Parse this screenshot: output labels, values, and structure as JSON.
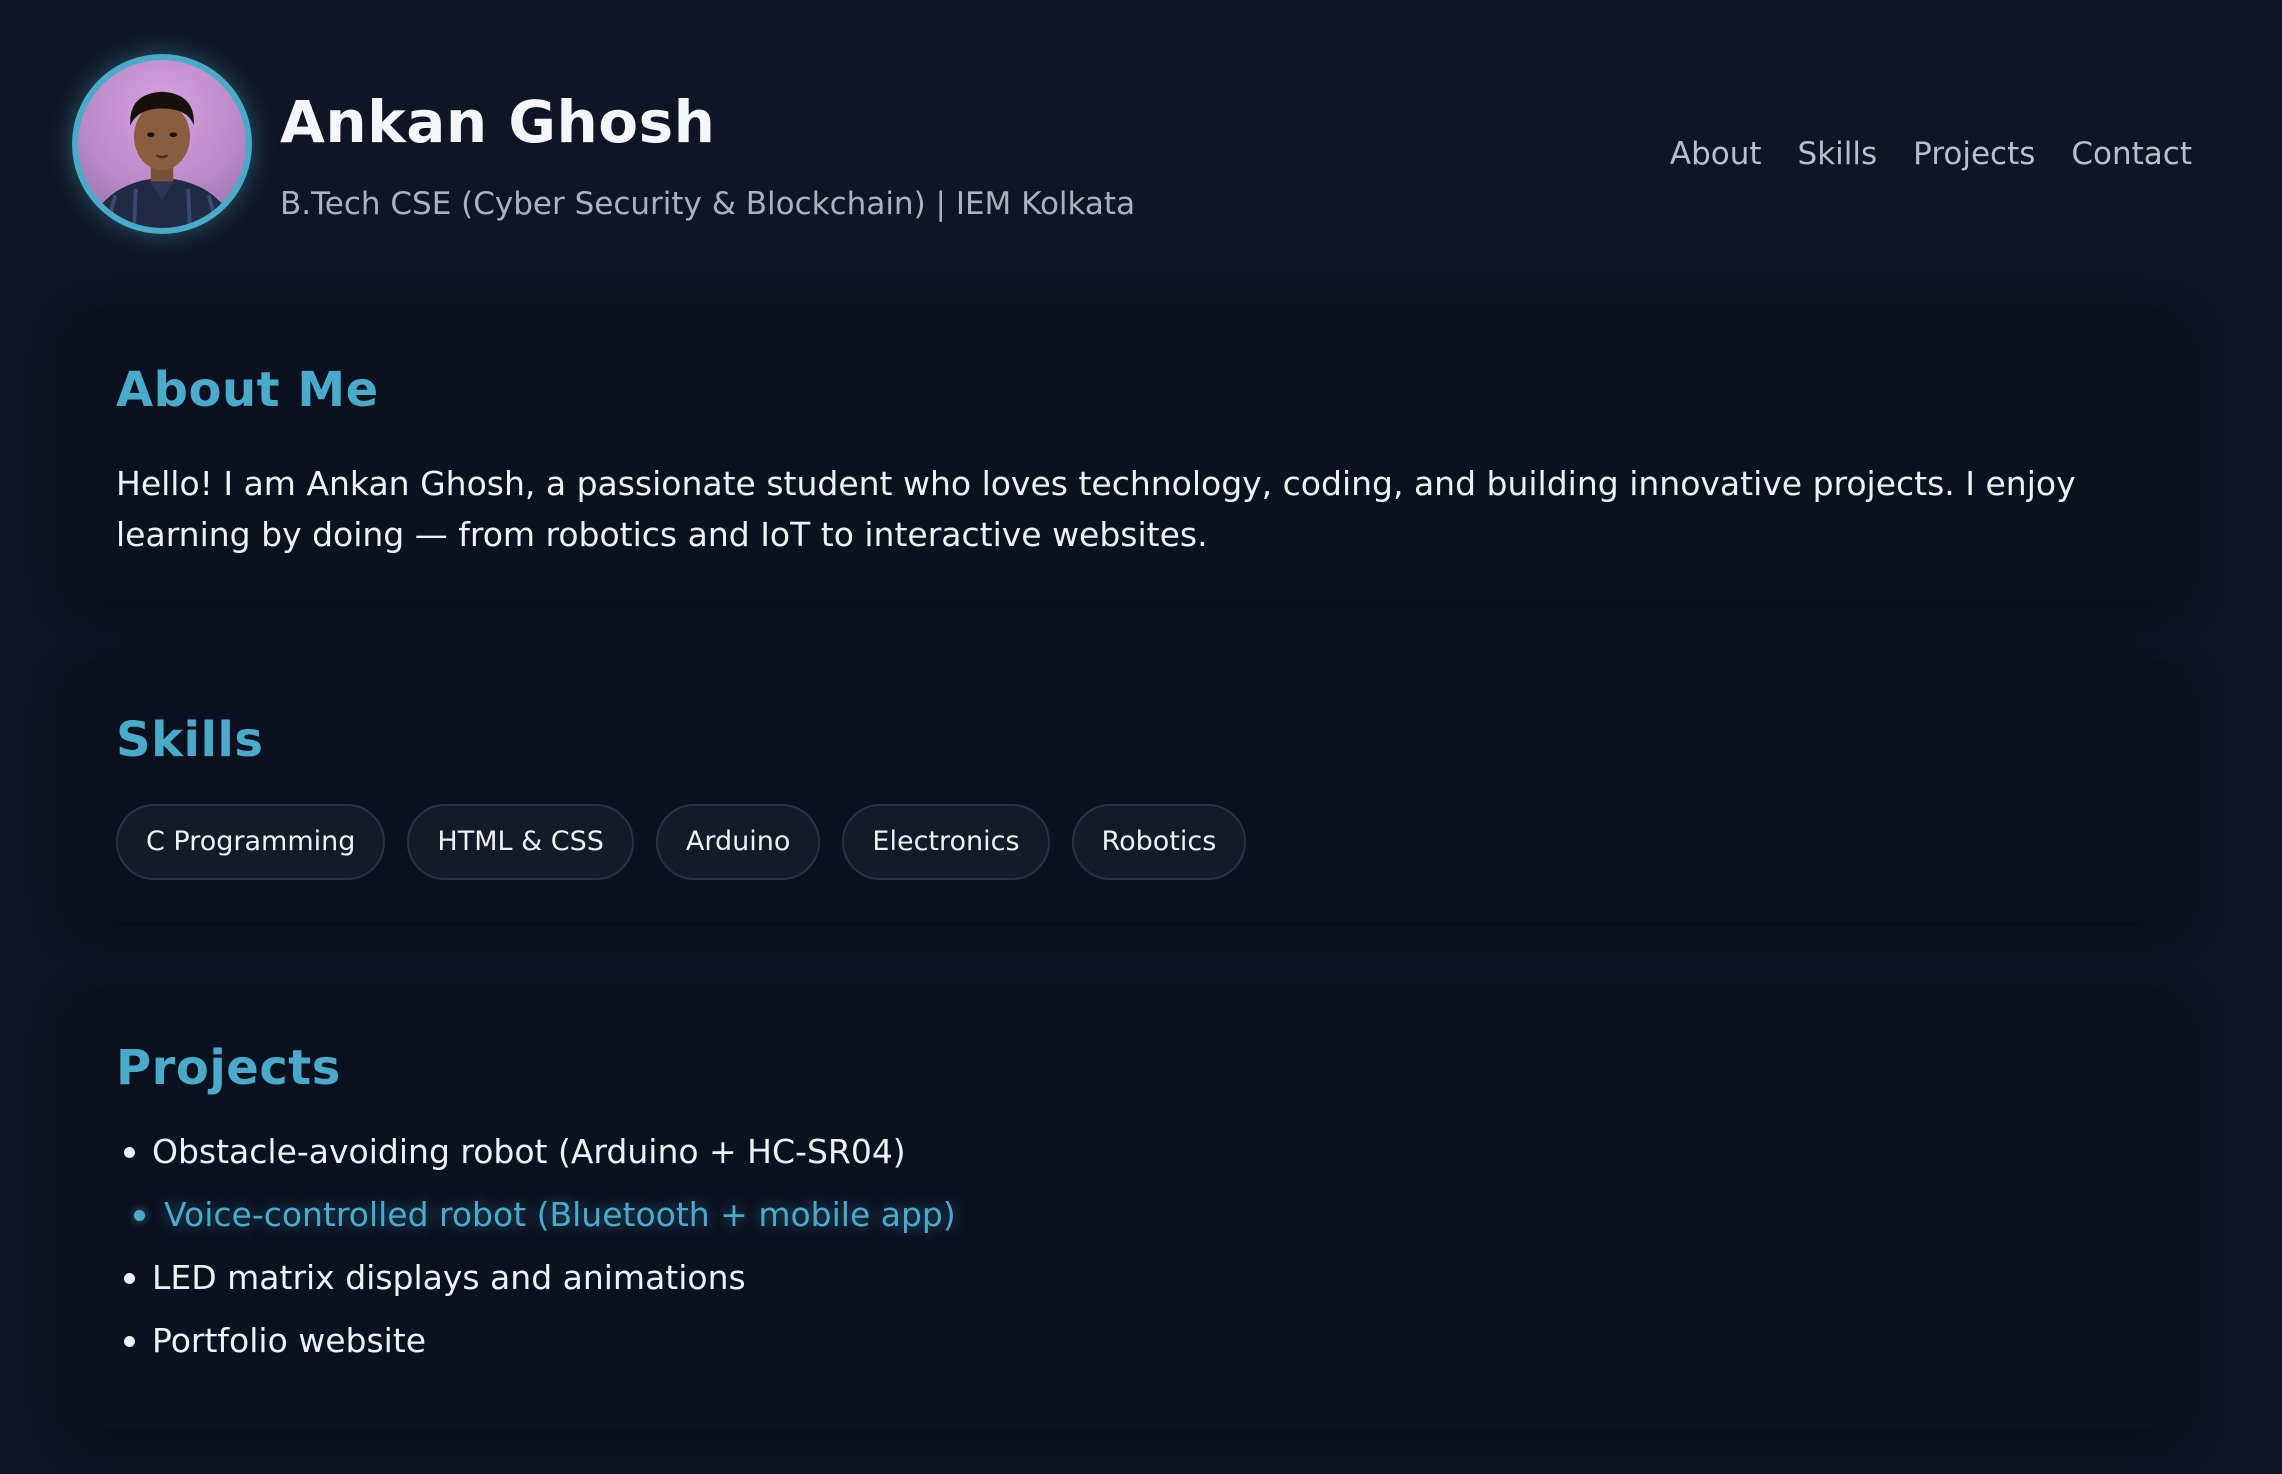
{
  "profile": {
    "name": "Ankan Ghosh",
    "tagline": "B.Tech CSE (Cyber Security & Blockchain) | IEM Kolkata"
  },
  "nav": {
    "items": [
      "About",
      "Skills",
      "Projects",
      "Contact"
    ]
  },
  "about": {
    "heading": "About Me",
    "text": "Hello! I am Ankan Ghosh, a passionate student who loves technology, coding, and building innovative projects. I enjoy learning by doing — from robotics and IoT to interactive websites."
  },
  "skills": {
    "heading": "Skills",
    "items": [
      "C Programming",
      "HTML & CSS",
      "Arduino",
      "Electronics",
      "Robotics"
    ]
  },
  "projects": {
    "heading": "Projects",
    "items": [
      "Obstacle-avoiding robot (Arduino + HC-SR04)",
      "Voice-controlled robot (Bluetooth + mobile app)",
      "LED matrix displays and animations",
      "Portfolio website"
    ]
  },
  "colors": {
    "background": "#0f1524",
    "card": "#0c1120",
    "accent": "#49aac9",
    "text": "#eef1f6",
    "muted": "#a9b2c2"
  }
}
